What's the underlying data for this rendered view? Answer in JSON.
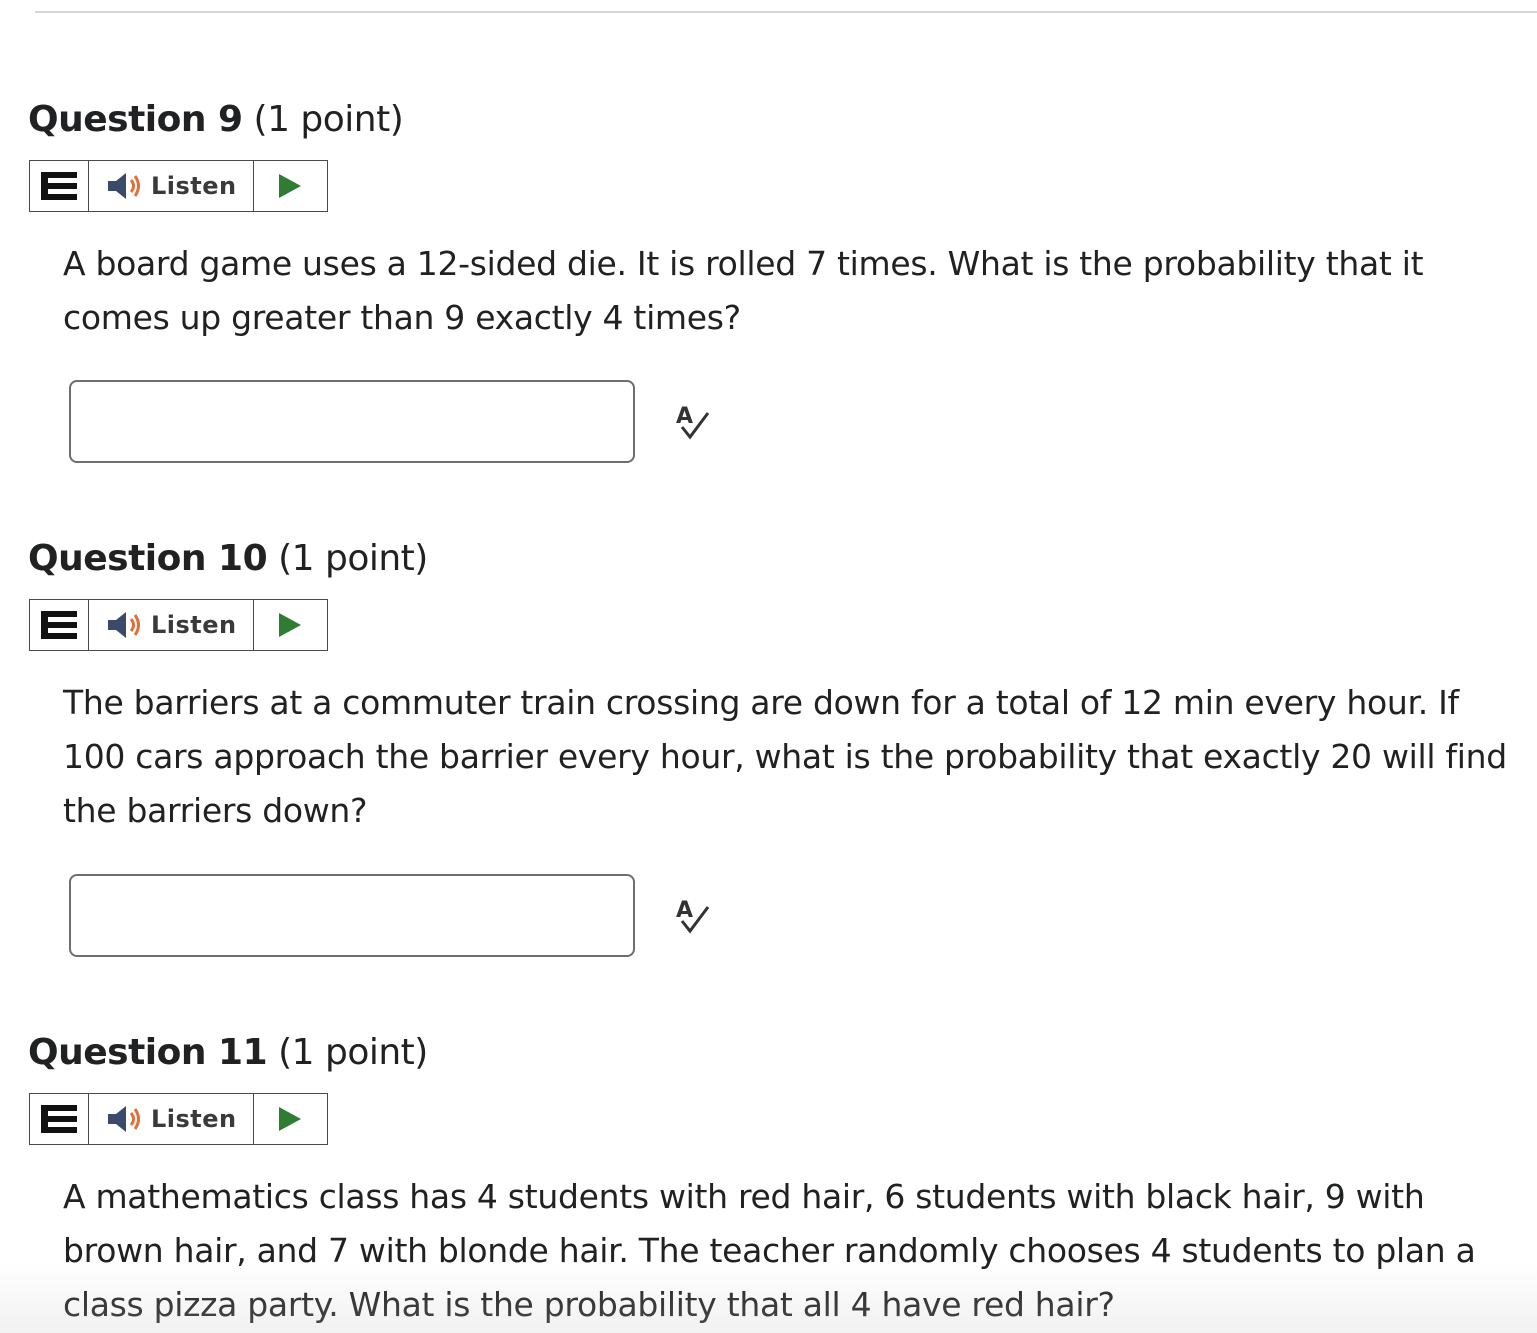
{
  "questions": [
    {
      "name": "Question 9",
      "points": "(1 point)",
      "listen_label": "Listen",
      "text": "A board game uses a 12-sided die. It is rolled 7 times. What is the probability that it comes up greater than 9 exactly 4 times?",
      "answer_value": ""
    },
    {
      "name": "Question 10",
      "points": "(1 point)",
      "listen_label": "Listen",
      "text": "The barriers at a commuter train crossing are down for a total of 12 min every hour. If 100 cars approach the barrier every hour, what is the probability that exactly 20 will find the barriers down?",
      "answer_value": ""
    },
    {
      "name": "Question 11",
      "points": "(1 point)",
      "listen_label": "Listen",
      "text": "A mathematics class has 4 students with red hair, 6 students with black hair, 9 with brown hair, and 7 with blonde hair. The teacher randomly chooses 4 students to plan a class pizza party. What is the probability that all 4 have red hair?"
    }
  ],
  "icons": {
    "menu": "hamburger-menu-icon",
    "speaker": "speaker-icon",
    "play": "play-icon",
    "spellcheck": "spellcheck-icon"
  },
  "colors": {
    "text": "#202122",
    "play_green": "#2e7d32",
    "speaker_orange": "#e0703a",
    "speaker_dark": "#3b4a6b",
    "border": "#4a4a4a"
  }
}
